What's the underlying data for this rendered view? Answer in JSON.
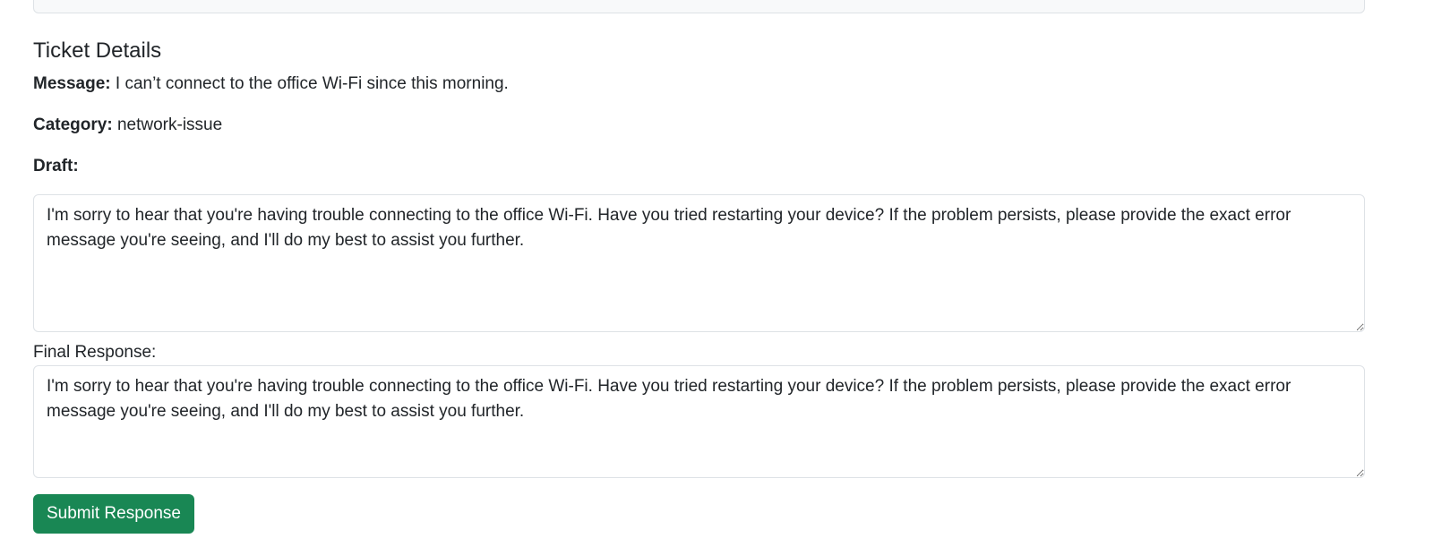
{
  "ticket": {
    "section_title": "Ticket Details",
    "message_label": "Message:",
    "message_value": "I can’t connect to the office Wi-Fi since this morning.",
    "category_label": "Category:",
    "category_value": "network-issue",
    "draft_label": "Draft:",
    "draft_text": "I'm sorry to hear that you're having trouble connecting to the office Wi-Fi. Have you tried restarting your device? If the problem persists, please provide the exact error message you're seeing, and I'll do my best to assist you further.",
    "final_label": "Final Response:",
    "final_text": "I'm sorry to hear that you're having trouble connecting to the office Wi-Fi. Have you tried restarting your device? If the problem persists, please provide the exact error message you're seeing, and I'll do my best to assist you further.",
    "submit_label": "Submit Response"
  },
  "colors": {
    "submit_button": "#198754",
    "border": "#dee2e6",
    "text": "#212529",
    "panel_background": "#f8f9fa"
  }
}
